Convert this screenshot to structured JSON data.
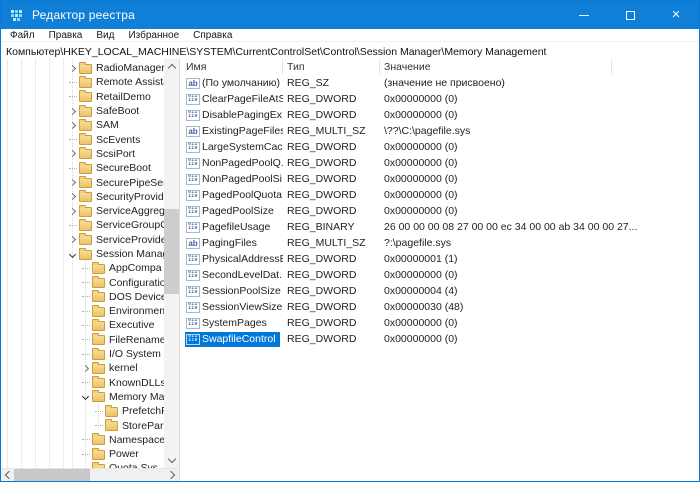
{
  "window": {
    "title": "Редактор реестра",
    "icons": {
      "close": "✕"
    }
  },
  "menu": {
    "items": [
      {
        "key": "file",
        "label": "Файл"
      },
      {
        "key": "edit",
        "label": "Правка"
      },
      {
        "key": "view",
        "label": "Вид"
      },
      {
        "key": "favorites",
        "label": "Избранное"
      },
      {
        "key": "help",
        "label": "Справка"
      }
    ]
  },
  "address_bar": {
    "value": "Компьютер\\HKEY_LOCAL_MACHINE\\SYSTEM\\CurrentControlSet\\Control\\Session Manager\\Memory Management"
  },
  "tree": {
    "items": [
      {
        "label": "RadioManager",
        "level": 0,
        "expander": "collapsed"
      },
      {
        "label": "Remote Assista",
        "level": 0,
        "expander": "none"
      },
      {
        "label": "RetailDemo",
        "level": 0,
        "expander": "none"
      },
      {
        "label": "SafeBoot",
        "level": 0,
        "expander": "collapsed"
      },
      {
        "label": "SAM",
        "level": 0,
        "expander": "collapsed"
      },
      {
        "label": "ScEvents",
        "level": 0,
        "expander": "none"
      },
      {
        "label": "ScsiPort",
        "level": 0,
        "expander": "collapsed"
      },
      {
        "label": "SecureBoot",
        "level": 0,
        "expander": "none"
      },
      {
        "label": "SecurePipeSer",
        "level": 0,
        "expander": "collapsed"
      },
      {
        "label": "SecurityProvide",
        "level": 0,
        "expander": "collapsed"
      },
      {
        "label": "ServiceAggreg",
        "level": 0,
        "expander": "collapsed"
      },
      {
        "label": "ServiceGroupO",
        "level": 0,
        "expander": "none"
      },
      {
        "label": "ServiceProvide",
        "level": 0,
        "expander": "collapsed"
      },
      {
        "label": "Session Manag",
        "level": 0,
        "expander": "expanded"
      },
      {
        "label": "AppCompa",
        "level": 1,
        "expander": "none"
      },
      {
        "label": "Configuratio",
        "level": 1,
        "expander": "none"
      },
      {
        "label": "DOS Device",
        "level": 1,
        "expander": "none"
      },
      {
        "label": "Environmen",
        "level": 1,
        "expander": "none"
      },
      {
        "label": "Executive",
        "level": 1,
        "expander": "none"
      },
      {
        "label": "FileRename",
        "level": 1,
        "expander": "none"
      },
      {
        "label": "I/O System",
        "level": 1,
        "expander": "none"
      },
      {
        "label": "kernel",
        "level": 1,
        "expander": "collapsed"
      },
      {
        "label": "KnownDLLs",
        "level": 1,
        "expander": "none"
      },
      {
        "label": "Memory Ma",
        "level": 1,
        "expander": "expanded"
      },
      {
        "label": "PrefetchP",
        "level": 2,
        "expander": "none"
      },
      {
        "label": "StorePar",
        "level": 2,
        "expander": "none"
      },
      {
        "label": "Namespace",
        "level": 1,
        "expander": "none"
      },
      {
        "label": "Power",
        "level": 1,
        "expander": "none"
      },
      {
        "label": "Quota Sys",
        "level": 1,
        "expander": "none"
      }
    ]
  },
  "list": {
    "columns": [
      "Имя",
      "Тип",
      "Значение"
    ],
    "rows": [
      {
        "name": "(По умолчанию)",
        "type": "REG_SZ",
        "value": "(значение не присвоено)",
        "icon": "string",
        "selected": false
      },
      {
        "name": "ClearPageFileAtS...",
        "type": "REG_DWORD",
        "value": "0x00000000 (0)",
        "icon": "dword",
        "selected": false
      },
      {
        "name": "DisablePagingEx...",
        "type": "REG_DWORD",
        "value": "0x00000000 (0)",
        "icon": "dword",
        "selected": false
      },
      {
        "name": "ExistingPageFiles",
        "type": "REG_MULTI_SZ",
        "value": "\\??\\C:\\pagefile.sys",
        "icon": "string",
        "selected": false
      },
      {
        "name": "LargeSystemCac...",
        "type": "REG_DWORD",
        "value": "0x00000000 (0)",
        "icon": "dword",
        "selected": false
      },
      {
        "name": "NonPagedPoolQ...",
        "type": "REG_DWORD",
        "value": "0x00000000 (0)",
        "icon": "dword",
        "selected": false
      },
      {
        "name": "NonPagedPoolSi...",
        "type": "REG_DWORD",
        "value": "0x00000000 (0)",
        "icon": "dword",
        "selected": false
      },
      {
        "name": "PagedPoolQuota",
        "type": "REG_DWORD",
        "value": "0x00000000 (0)",
        "icon": "dword",
        "selected": false
      },
      {
        "name": "PagedPoolSize",
        "type": "REG_DWORD",
        "value": "0x00000000 (0)",
        "icon": "dword",
        "selected": false
      },
      {
        "name": "PagefileUsage",
        "type": "REG_BINARY",
        "value": "26 00 00 00 08 27 00 00 ec 34 00 00 ab 34 00 00 27...",
        "icon": "dword",
        "selected": false
      },
      {
        "name": "PagingFiles",
        "type": "REG_MULTI_SZ",
        "value": "?:\\pagefile.sys",
        "icon": "string",
        "selected": false
      },
      {
        "name": "PhysicalAddressE...",
        "type": "REG_DWORD",
        "value": "0x00000001 (1)",
        "icon": "dword",
        "selected": false
      },
      {
        "name": "SecondLevelDat...",
        "type": "REG_DWORD",
        "value": "0x00000000 (0)",
        "icon": "dword",
        "selected": false
      },
      {
        "name": "SessionPoolSize",
        "type": "REG_DWORD",
        "value": "0x00000004 (4)",
        "icon": "dword",
        "selected": false
      },
      {
        "name": "SessionViewSize",
        "type": "REG_DWORD",
        "value": "0x00000030 (48)",
        "icon": "dword",
        "selected": false
      },
      {
        "name": "SystemPages",
        "type": "REG_DWORD",
        "value": "0x00000000 (0)",
        "icon": "dword",
        "selected": false
      },
      {
        "name": "SwapfileControl",
        "type": "REG_DWORD",
        "value": "0x00000000 (0)",
        "icon": "dword",
        "selected": true
      }
    ]
  },
  "colors": {
    "accent": "#0078d7",
    "titlebar": "#0f7fd7",
    "folder": "#edc168"
  }
}
